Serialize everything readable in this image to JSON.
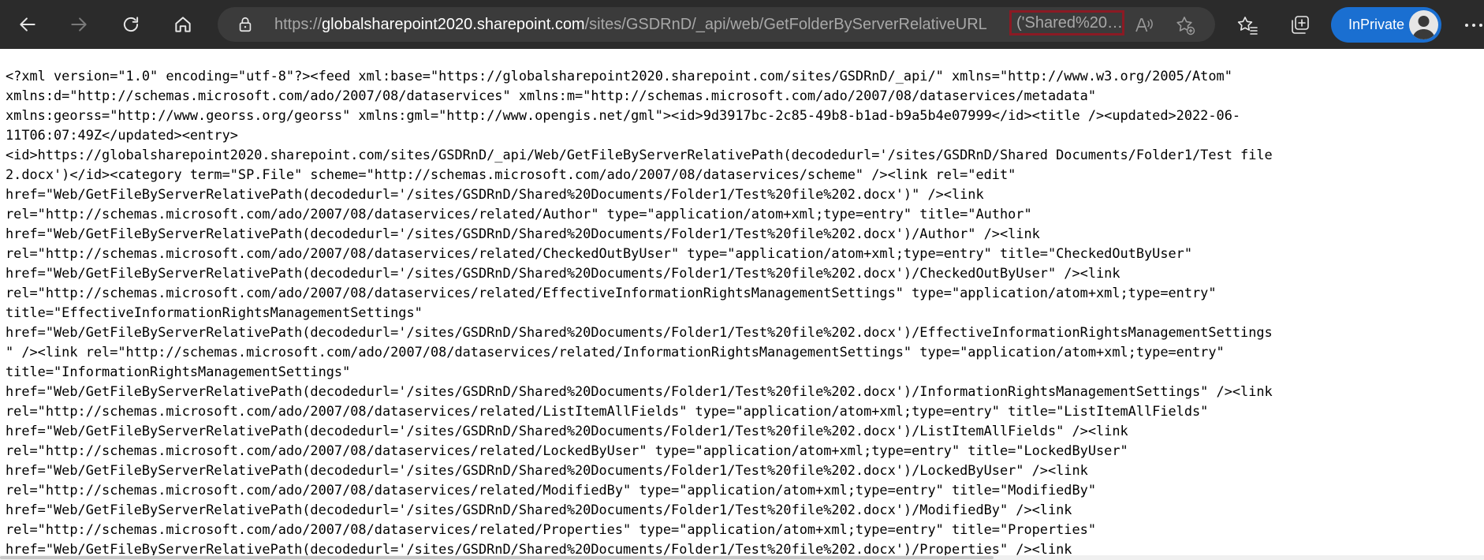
{
  "browser": {
    "url": {
      "prefix": "https://",
      "host": "globalsharepoint2020.sharepoint.com",
      "path": "/sites/GSDRnD/_api/web/GetFolderByServerRelativeURL",
      "highlighted": "('Shared%20…"
    },
    "inprivate_label": "InPrivate"
  },
  "icons": {
    "back": "arrow-left-icon",
    "forward": "arrow-right-icon",
    "refresh": "refresh-icon",
    "home": "home-icon",
    "lock": "lock-icon",
    "read_aloud": "read-aloud-icon",
    "add_favorite": "star-plus-icon",
    "favorites": "favorites-icon",
    "collections": "collections-icon",
    "more": "more-icon"
  },
  "colors": {
    "toolbar_bg": "#2b2b2b",
    "address_bg": "#3b3b3b",
    "highlight_border": "#8b1a24",
    "inprivate_bg": "#1a6fd1"
  },
  "document": {
    "text": "<?xml version=\"1.0\" encoding=\"utf-8\"?><feed xml:base=\"https://globalsharepoint2020.sharepoint.com/sites/GSDRnD/_api/\" xmlns=\"http://www.w3.org/2005/Atom\"\nxmlns:d=\"http://schemas.microsoft.com/ado/2007/08/dataservices\" xmlns:m=\"http://schemas.microsoft.com/ado/2007/08/dataservices/metadata\"\nxmlns:georss=\"http://www.georss.org/georss\" xmlns:gml=\"http://www.opengis.net/gml\"><id>9d3917bc-2c85-49b8-b1ad-b9a5b4e07999</id><title /><updated>2022-06-\n11T06:07:49Z</updated><entry>\n<id>https://globalsharepoint2020.sharepoint.com/sites/GSDRnD/_api/Web/GetFileByServerRelativePath(decodedurl='/sites/GSDRnD/Shared Documents/Folder1/Test file\n2.docx')</id><category term=\"SP.File\" scheme=\"http://schemas.microsoft.com/ado/2007/08/dataservices/scheme\" /><link rel=\"edit\"\nhref=\"Web/GetFileByServerRelativePath(decodedurl='/sites/GSDRnD/Shared%20Documents/Folder1/Test%20file%202.docx')\" /><link\nrel=\"http://schemas.microsoft.com/ado/2007/08/dataservices/related/Author\" type=\"application/atom+xml;type=entry\" title=\"Author\"\nhref=\"Web/GetFileByServerRelativePath(decodedurl='/sites/GSDRnD/Shared%20Documents/Folder1/Test%20file%202.docx')/Author\" /><link\nrel=\"http://schemas.microsoft.com/ado/2007/08/dataservices/related/CheckedOutByUser\" type=\"application/atom+xml;type=entry\" title=\"CheckedOutByUser\"\nhref=\"Web/GetFileByServerRelativePath(decodedurl='/sites/GSDRnD/Shared%20Documents/Folder1/Test%20file%202.docx')/CheckedOutByUser\" /><link\nrel=\"http://schemas.microsoft.com/ado/2007/08/dataservices/related/EffectiveInformationRightsManagementSettings\" type=\"application/atom+xml;type=entry\"\ntitle=\"EffectiveInformationRightsManagementSettings\"\nhref=\"Web/GetFileByServerRelativePath(decodedurl='/sites/GSDRnD/Shared%20Documents/Folder1/Test%20file%202.docx')/EffectiveInformationRightsManagementSettings\n\" /><link rel=\"http://schemas.microsoft.com/ado/2007/08/dataservices/related/InformationRightsManagementSettings\" type=\"application/atom+xml;type=entry\"\ntitle=\"InformationRightsManagementSettings\"\nhref=\"Web/GetFileByServerRelativePath(decodedurl='/sites/GSDRnD/Shared%20Documents/Folder1/Test%20file%202.docx')/InformationRightsManagementSettings\" /><link\nrel=\"http://schemas.microsoft.com/ado/2007/08/dataservices/related/ListItemAllFields\" type=\"application/atom+xml;type=entry\" title=\"ListItemAllFields\"\nhref=\"Web/GetFileByServerRelativePath(decodedurl='/sites/GSDRnD/Shared%20Documents/Folder1/Test%20file%202.docx')/ListItemAllFields\" /><link\nrel=\"http://schemas.microsoft.com/ado/2007/08/dataservices/related/LockedByUser\" type=\"application/atom+xml;type=entry\" title=\"LockedByUser\"\nhref=\"Web/GetFileByServerRelativePath(decodedurl='/sites/GSDRnD/Shared%20Documents/Folder1/Test%20file%202.docx')/LockedByUser\" /><link\nrel=\"http://schemas.microsoft.com/ado/2007/08/dataservices/related/ModifiedBy\" type=\"application/atom+xml;type=entry\" title=\"ModifiedBy\"\nhref=\"Web/GetFileByServerRelativePath(decodedurl='/sites/GSDRnD/Shared%20Documents/Folder1/Test%20file%202.docx')/ModifiedBy\" /><link\nrel=\"http://schemas.microsoft.com/ado/2007/08/dataservices/related/Properties\" type=\"application/atom+xml;type=entry\" title=\"Properties\"\nhref=\"Web/GetFileByServerRelativePath(decodedurl='/sites/GSDRnD/Shared%20Documents/Folder1/Test%20file%202.docx')/Properties\" /><link"
  }
}
